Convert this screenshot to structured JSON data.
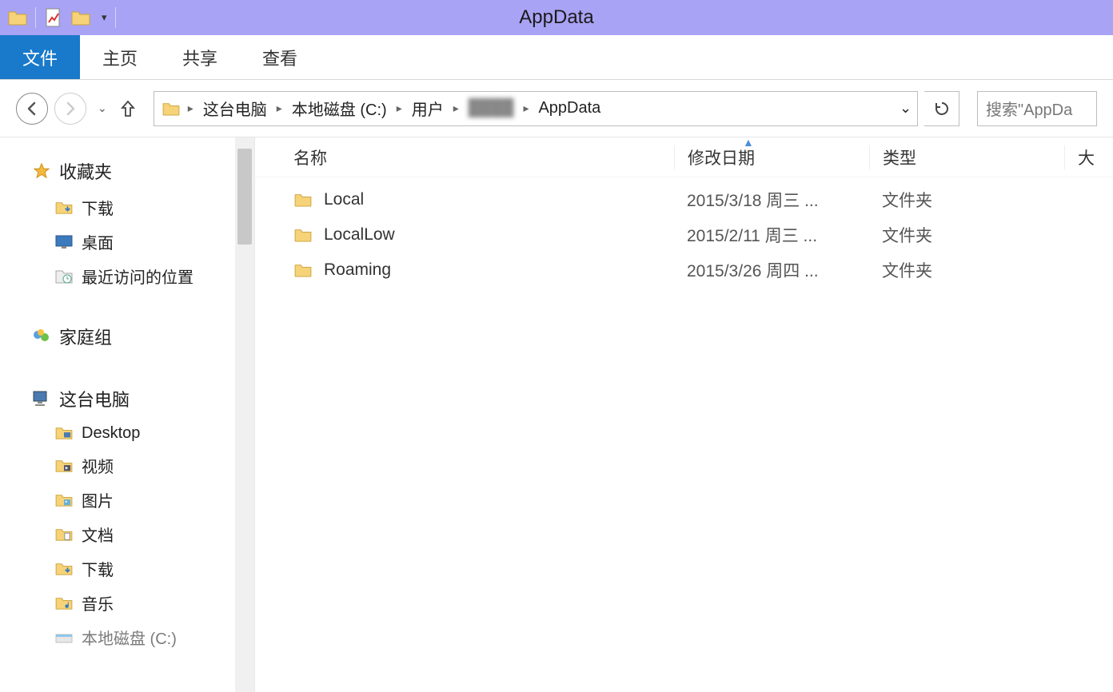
{
  "window": {
    "title": "AppData"
  },
  "ribbon": {
    "file_tab": "文件",
    "tabs": [
      "主页",
      "共享",
      "查看"
    ]
  },
  "breadcrumb": {
    "items": [
      "这台电脑",
      "本地磁盘 (C:)",
      "用户",
      "",
      "AppData"
    ]
  },
  "search": {
    "placeholder": "搜索\"AppDa"
  },
  "columns": {
    "name": "名称",
    "date": "修改日期",
    "type": "类型",
    "size": "大"
  },
  "files": [
    {
      "name": "Local",
      "date": "2015/3/18 周三 ...",
      "type": "文件夹"
    },
    {
      "name": "LocalLow",
      "date": "2015/2/11 周三 ...",
      "type": "文件夹"
    },
    {
      "name": "Roaming",
      "date": "2015/3/26 周四 ...",
      "type": "文件夹"
    }
  ],
  "sidebar": {
    "favorites": {
      "label": "收藏夹",
      "items": [
        "下载",
        "桌面",
        "最近访问的位置"
      ]
    },
    "homegroup": {
      "label": "家庭组"
    },
    "thispc": {
      "label": "这台电脑",
      "items": [
        "Desktop",
        "视频",
        "图片",
        "文档",
        "下载",
        "音乐",
        "本地磁盘 (C:)"
      ]
    }
  }
}
